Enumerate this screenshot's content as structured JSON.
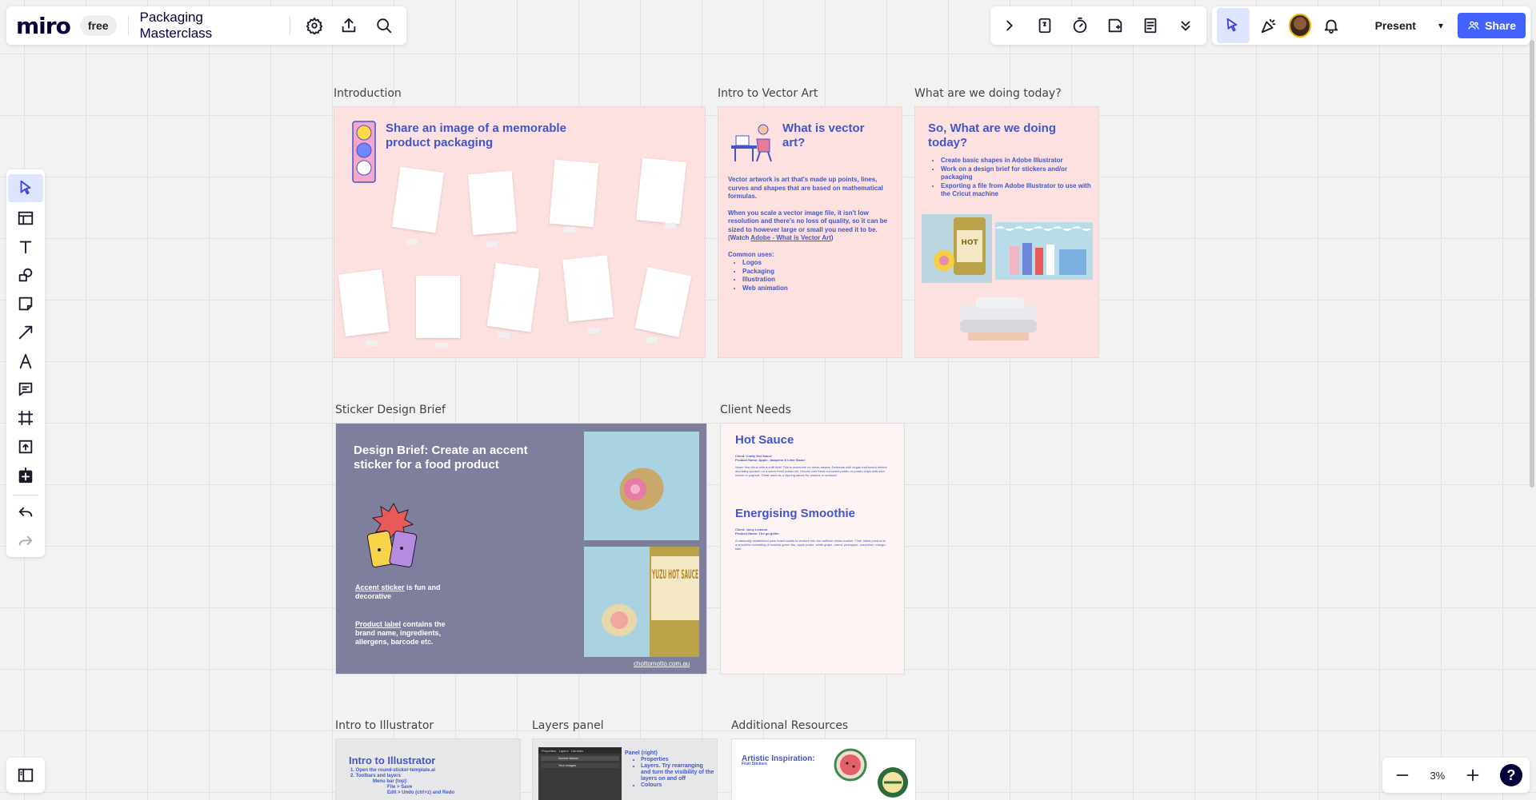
{
  "app": {
    "logo": "miro",
    "plan": "free",
    "board_title": "Packaging Masterclass"
  },
  "toolbar_right": {
    "present_label": "Present",
    "share_label": "Share",
    "zoom": "3%",
    "help": "?"
  },
  "frames": {
    "introduction": {
      "label": "Introduction",
      "title": "Share an image of a memorable product packaging"
    },
    "vector": {
      "label": "Intro to Vector Art",
      "title": "What is vector art?",
      "p1": "Vector artwork is art that's made up points, lines, curves and shapes that are based on mathematical formulas.",
      "p2": "When you scale a vector image file, it isn't low resolution and there's no loss of quality, so it can be sized to however large or small you need it to be. (Watch ",
      "link": "Adobe - What is Vector Art",
      "p2_end": ")",
      "uses_heading": "Common uses:",
      "uses": [
        "Logos",
        "Packaging",
        "Illustration",
        "Web animation"
      ]
    },
    "today": {
      "label": "What are we doing today?",
      "title": "So, What are we doing today?",
      "items": [
        "Create basic shapes in Adobe Illustrator",
        "Work on a design brief for stickers and/or packaging",
        "Exporting a file from Adobe Illustrator to use with the Cricut machine"
      ]
    },
    "brief": {
      "label": "Sticker Design Brief",
      "title": "Design Brief: Create an accent sticker for a food product",
      "accent_link": "Accent sticker",
      "accent_rest": " is fun and decorative",
      "label_link": "Product label",
      "label_rest": " contains the brand name, ingredients, allergens, barcode etc.",
      "url": "chottomotto.com.au",
      "jar_text": "YUZU HOT SAUCE"
    },
    "client": {
      "label": "Client Needs",
      "hot_sauce_title": "Hot Sauce",
      "hot_sauce_meta1": "Client: Crafty Hot Sauce",
      "hot_sauce_meta2": "Product Name: Apple, Jalapeno & Lime Sauce",
      "hot_sauce_desc": "Warm fine citrus with a chilli kick! This is awesome on meat, salads. Delicious with vegan fruit based dishes and baby spinach on a warm fresh bread roll. Drizzle over fresh cut sweet potato or potato chips with sour cream or yoghurt. Great used as a dipping sauce for prawns or seafood.",
      "smoothie_title": "Energising Smoothie",
      "smoothie_meta1": "Client: Juicy Lemons",
      "smoothie_meta2": "Product Name: The go getter",
      "smoothie_desc": "A nationally established juice brand wants to venture into the caffeine drinks market. Their latest product is a smoothie consisting of matcha green tea, apple puree, white grape, carrot, pineapple, cucumber, mango, kale."
    },
    "illustrator": {
      "label": "Intro to Illustrator",
      "title": "Intro to Illustrator",
      "s1": "1. Open the round-sticker-template.ai",
      "s2": "2. Toolbars and layers",
      "s3": "Menu bar (top):",
      "s4": "File > Save",
      "s5": "Edit > Undo (ctrl+z) and Redo"
    },
    "layers": {
      "label": "Layers panel",
      "h": "Panel (right)",
      "items": [
        "Properties",
        "Layers. Try rearranging and turn the visibility of the layers on and off",
        "Colours"
      ],
      "tabs": "Properties   Layers   Libraries",
      "row1": "Accent sticker",
      "row2": "Your images"
    },
    "resources": {
      "label": "Additional Resources",
      "title": "Artistic Inspiration:",
      "sub": "Fruit Stickers"
    }
  },
  "colors": {
    "accent": "#4262ff",
    "frame_title": "#4356c9",
    "pink": "#fde1e1",
    "slate": "#7e7f9c"
  }
}
